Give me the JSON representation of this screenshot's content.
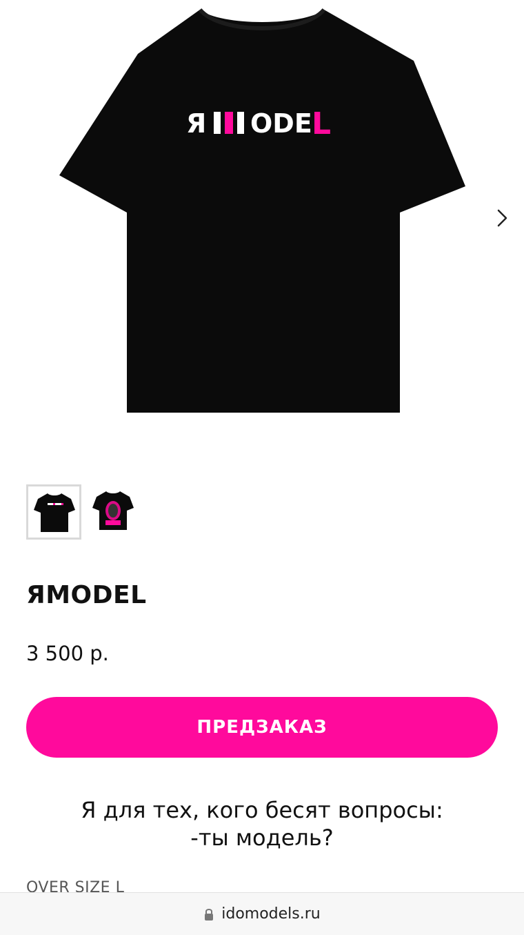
{
  "product": {
    "title": "ЯMODEL",
    "price": "3 500 р.",
    "preorder_label": "ПРЕДЗАКАЗ",
    "description_line1": "Я для тех, кого бесят вопросы:",
    "description_line2": "-ты модель?",
    "size_text": "OVER SIZE L",
    "print_text": "ЯMODEL"
  },
  "gallery": {
    "thumbnails": [
      {
        "name": "back-print",
        "active": true
      },
      {
        "name": "front-print",
        "active": false
      }
    ],
    "next_icon": "chevron-right-icon"
  },
  "browser": {
    "url": "idomodels.ru",
    "lock_icon": "lock-icon"
  },
  "colors": {
    "accent": "#ff0a9c",
    "shirt": "#0b0b0b"
  }
}
